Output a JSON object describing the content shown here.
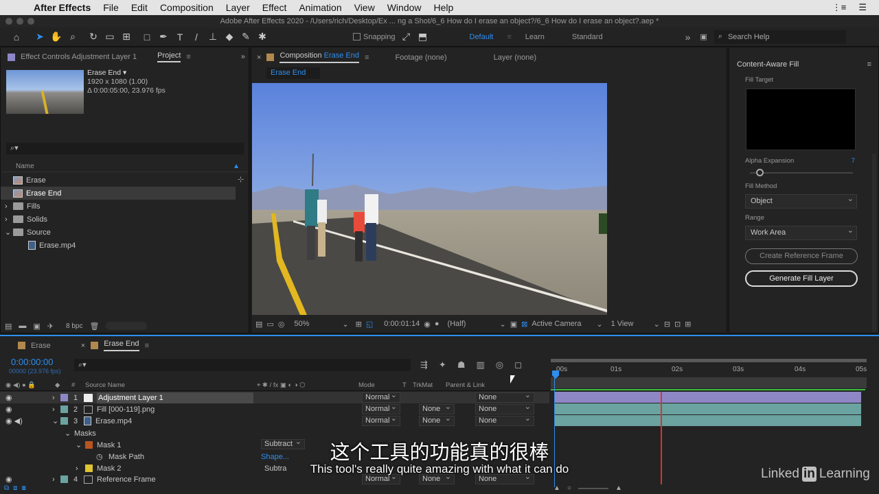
{
  "menubar": {
    "app": "After Effects",
    "items": [
      "File",
      "Edit",
      "Composition",
      "Layer",
      "Effect",
      "Animation",
      "View",
      "Window",
      "Help"
    ]
  },
  "titlebar": {
    "title": "Adobe After Effects 2020 - /Users/rich/Desktop/Ex ... ng a Shot/6_6 How do I erase an object?/6_6 How do I erase an object?.aep *"
  },
  "toolbar": {
    "snapping": "Snapping",
    "workspaces": [
      "Default",
      "Learn",
      "Standard"
    ],
    "search_placeholder": "Search Help"
  },
  "project_panel": {
    "tab_effect": "Effect Controls Adjustment Layer 1",
    "tab_project": "Project",
    "item_name": "Erase End ▾",
    "item_res": "1920 x 1080 (1.00)",
    "item_dur": "Δ 0:00:05:00, 23.976 fps",
    "col_name": "Name",
    "items": [
      {
        "label": "Erase"
      },
      {
        "label": "Erase End"
      },
      {
        "label": "Fills"
      },
      {
        "label": "Solids"
      },
      {
        "label": "Source"
      },
      {
        "label": "Erase.mp4"
      }
    ],
    "bpc": "8 bpc"
  },
  "comp_panel": {
    "tab_comp_prefix": "Composition",
    "tab_comp_name": "Erase End",
    "tab_footage": "Footage (none)",
    "tab_layer": "Layer (none)",
    "flow_tab": "Erase End",
    "zoom": "50%",
    "timecode": "0:00:01:14",
    "resolution": "(Half)",
    "camera": "Active Camera",
    "views": "1 View"
  },
  "caf_panel": {
    "title": "Content-Aware Fill",
    "fill_target": "Fill Target",
    "alpha_label": "Alpha Expansion",
    "alpha_value": "7",
    "fill_method_label": "Fill Method",
    "fill_method": "Object",
    "range_label": "Range",
    "range": "Work Area",
    "btn_ref": "Create Reference Frame",
    "btn_generate": "Generate Fill Layer"
  },
  "timeline": {
    "tabs": [
      "Erase",
      "Erase End"
    ],
    "timecode": "0:00:00:00",
    "frames": "00000 (23.976 fps)",
    "cols": {
      "source": "Source Name",
      "mode": "Mode",
      "t": "T",
      "trkmat": "TrkMat",
      "parent": "Parent & Link"
    },
    "ruler": [
      "00s",
      "01s",
      "02s",
      "03s",
      "04s",
      "05s"
    ],
    "layers": [
      {
        "num": "1",
        "name": "Adjustment Layer 1",
        "mode": "Normal",
        "trk": "",
        "parent": "None"
      },
      {
        "num": "2",
        "name": "Fill [000-119].png",
        "mode": "Normal",
        "trk": "None",
        "parent": "None"
      },
      {
        "num": "3",
        "name": "Erase.mp4",
        "mode": "Normal",
        "trk": "None",
        "parent": "None"
      }
    ],
    "masks": "Masks",
    "mask1": "Mask 1",
    "mask1_mode": "Subtract",
    "mask_path": "Mask Path",
    "mask_path_val": "Shape...",
    "mask2": "Mask 2",
    "mask2_mode": "Subtra",
    "layer4": {
      "num": "4",
      "name": "Reference Frame",
      "mode": "Normal",
      "trk": "None",
      "parent": "None"
    }
  },
  "subtitle": {
    "zh": "这个工具的功能真的很棒",
    "en": "This tool's really quite amazing with what it can do"
  },
  "watermark": {
    "brand1": "Linked",
    "brand2": "in",
    "brand3": "Learning"
  },
  "colors": {
    "accent": "#2e8ff0",
    "playhead": "#e03030",
    "label_lavender": "#8e87c6",
    "label_teal": "#6aa3a0",
    "label_yellow": "#e0c531",
    "label_brown": "#b9551e"
  }
}
